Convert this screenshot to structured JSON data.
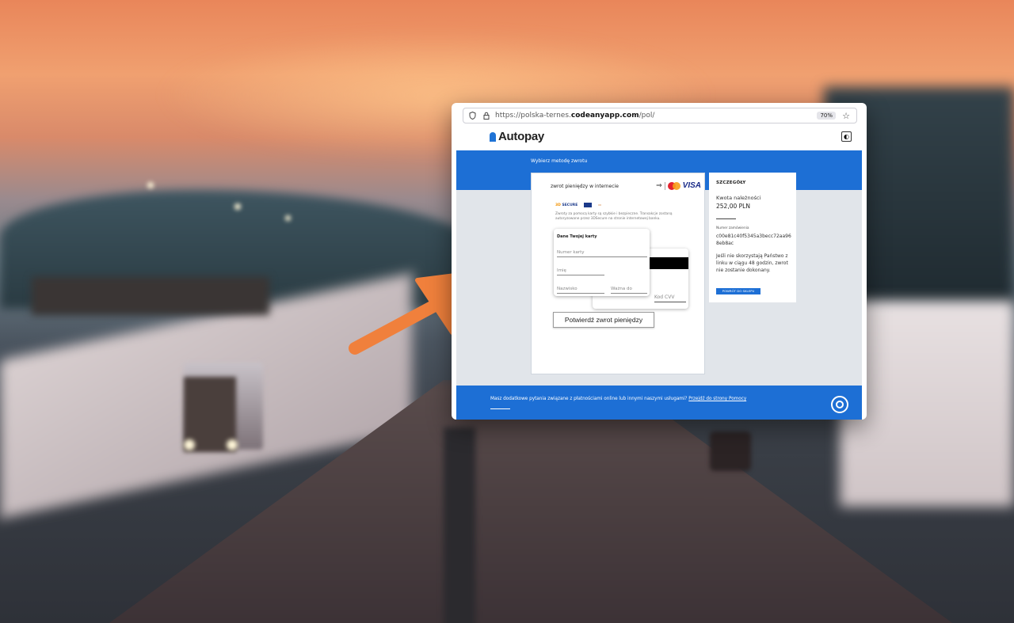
{
  "browser": {
    "url_prefix": "https://polska-ternes.",
    "url_domain": "codeanyapp.com",
    "url_suffix": "/pol/",
    "zoom": "70%"
  },
  "site": {
    "logo_text": "Autopay",
    "band_title": "Wybierz metodę zwrotu"
  },
  "payment": {
    "method_label": "zwrot pieniędzy w internecie",
    "brand_visa": "VISA",
    "secure_badge_a": "3D",
    "secure_badge_b": "SECURE",
    "secure_text": "Zwroty za pomocą karty są szybkie i bezpieczne. Transakcje zostaną autoryzowane przez 3DSecure na stronie internetowej banku.",
    "card_section_label": "Dane Twojej karty",
    "fields": {
      "number_placeholder": "Numer karty",
      "name_placeholder": "Imię",
      "surname_placeholder": "Nazwisko",
      "valid_placeholder": "Ważna do",
      "cvv_placeholder": "Kod CVV"
    },
    "confirm_label": "Potwierdź zwrot pieniędzy"
  },
  "details": {
    "heading": "SZCZEGÓŁY",
    "amount_label": "Kwota należności",
    "amount": "252,00 PLN",
    "order_label": "Numer zamówienia",
    "order_id": "c00e81c40f5345a3becc72aa968eb8ac",
    "note": "Jeśli nie skorzystają Państwo z linku w ciągu 48 godzin, zwrot nie zostanie dokonany.",
    "back_label": "POWRÓT DO SKLEPU"
  },
  "footer": {
    "question": "Masz dodatkowe pytania związane z płatnościami online lub innymi naszymi usługami?",
    "help_link": "Przejdź do strony Pomocy"
  },
  "colors": {
    "brand_blue": "#1d6fd5",
    "arrow": "#f0803c"
  }
}
